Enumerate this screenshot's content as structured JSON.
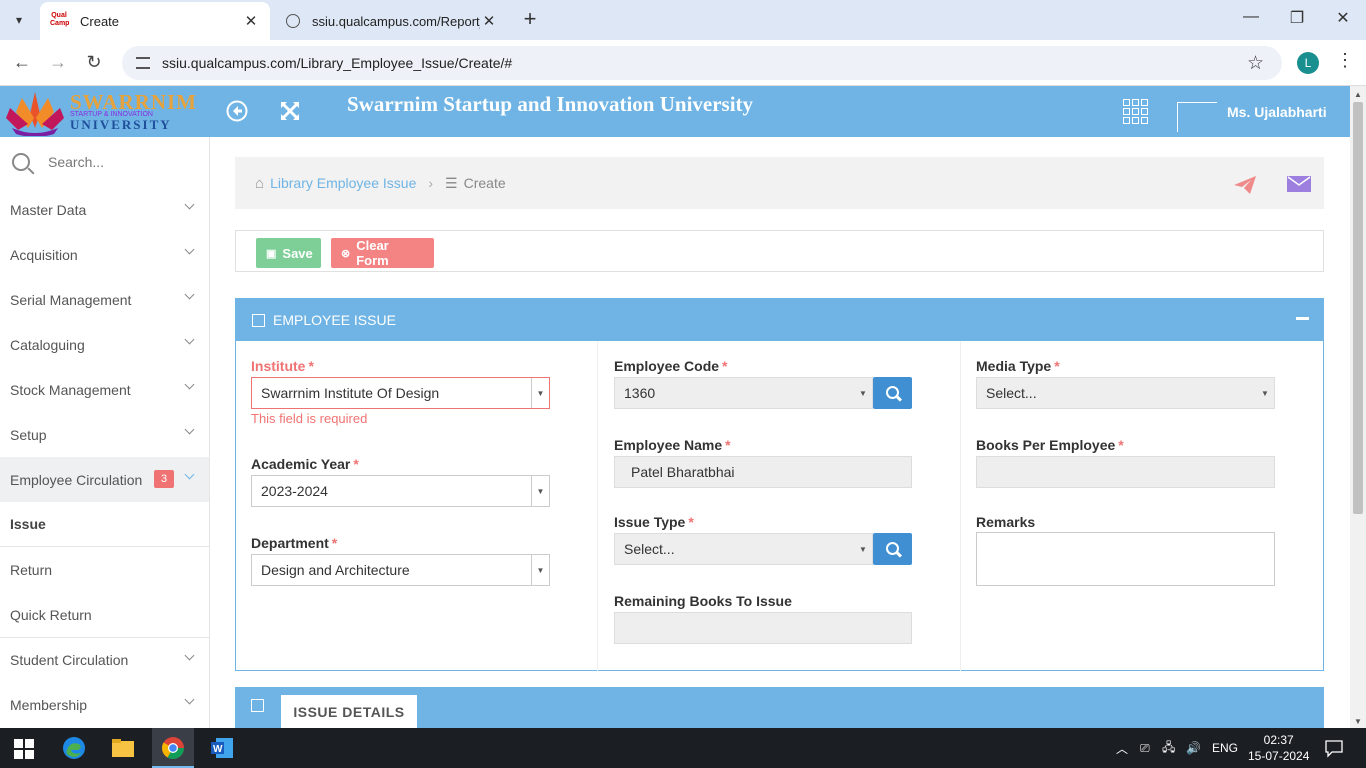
{
  "browser": {
    "tabs": [
      {
        "title": "Create",
        "active": true
      },
      {
        "title": "ssiu.qualcampus.com/Report_V",
        "active": false
      }
    ],
    "url": "ssiu.qualcampus.com/Library_Employee_Issue/Create/#",
    "profile_initial": "L"
  },
  "header": {
    "logo_line1": "SWARRNIM",
    "logo_line2": "STARTUP & INNOVATION",
    "logo_line3": "UNIVERSITY",
    "university_name": "Swarrnim Startup and Innovation University",
    "user_name": "Ms. Ujalabharti"
  },
  "sidebar": {
    "search_placeholder": "Search...",
    "items": [
      {
        "label": "Master Data"
      },
      {
        "label": "Acquisition"
      },
      {
        "label": "Serial Management"
      },
      {
        "label": "Cataloguing"
      },
      {
        "label": "Stock Management"
      },
      {
        "label": "Setup"
      },
      {
        "label": "Employee Circulation",
        "badge": "3"
      }
    ],
    "subitems": [
      {
        "label": "Issue"
      },
      {
        "label": "Return"
      },
      {
        "label": "Quick Return"
      }
    ],
    "items_after": [
      {
        "label": "Student Circulation"
      },
      {
        "label": "Membership"
      }
    ]
  },
  "breadcrumb": {
    "parent": "Library Employee Issue",
    "current": "Create"
  },
  "actions": {
    "save": "Save",
    "clear": "Clear Form"
  },
  "form": {
    "title": "EMPLOYEE ISSUE",
    "institute": {
      "label": "Institute",
      "value": "Swarrnim Institute Of Design",
      "error": "This field is required"
    },
    "academic_year": {
      "label": "Academic Year",
      "value": "2023-2024"
    },
    "department": {
      "label": "Department",
      "value": "Design and Architecture"
    },
    "employee_code": {
      "label": "Employee Code",
      "value": "1360"
    },
    "employee_name": {
      "label": "Employee Name",
      "value": "Patel Bharatbhai"
    },
    "issue_type": {
      "label": "Issue Type",
      "value": "Select..."
    },
    "remaining_books": {
      "label": "Remaining Books To Issue",
      "value": ""
    },
    "media_type": {
      "label": "Media Type",
      "value": "Select..."
    },
    "books_per_employee": {
      "label": "Books Per Employee",
      "value": ""
    },
    "remarks": {
      "label": "Remarks",
      "value": ""
    }
  },
  "issue_details": {
    "tab_label": "ISSUE DETAILS"
  },
  "taskbar": {
    "time": "02:37",
    "date": "15-07-2024",
    "lang": "ENG"
  }
}
